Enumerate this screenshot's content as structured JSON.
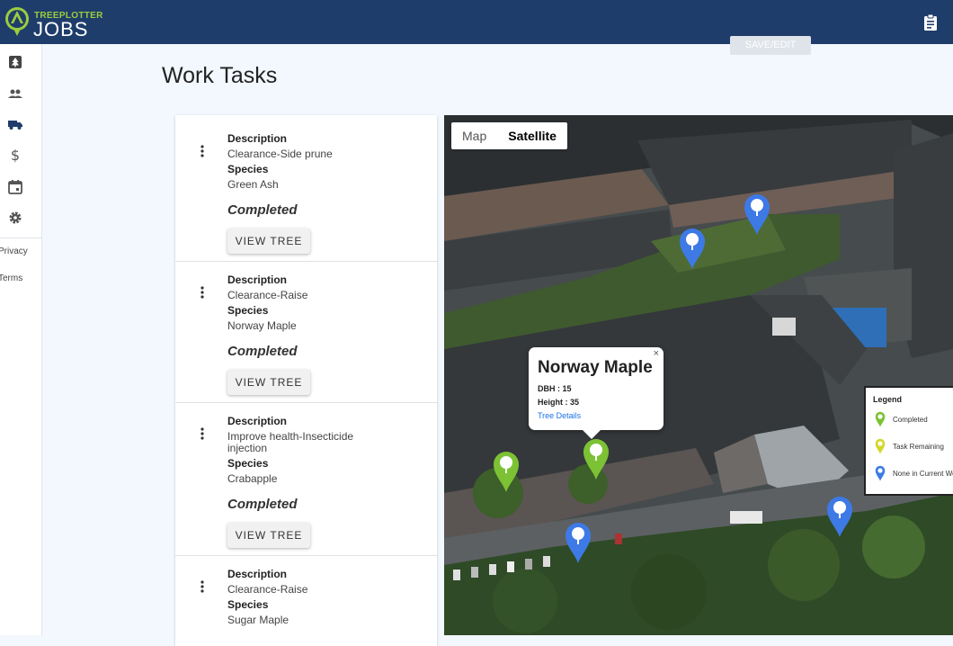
{
  "brand": {
    "top": "TREEPLOTTER",
    "bottom": "JOBS"
  },
  "header_action_label": "SAVE/EDIT",
  "page_title": "Work Tasks",
  "sidebar": {
    "links": [
      {
        "label": "Privacy"
      },
      {
        "label": "Terms"
      }
    ]
  },
  "tasks": [
    {
      "desc_label": "Description",
      "description": "Clearance-Side prune",
      "species_label": "Species",
      "species": "Green Ash",
      "status": "Completed",
      "button": "VIEW TREE"
    },
    {
      "desc_label": "Description",
      "description": "Clearance-Raise",
      "species_label": "Species",
      "species": "Norway Maple",
      "status": "Completed",
      "button": "VIEW TREE"
    },
    {
      "desc_label": "Description",
      "description": "Improve health-Insecticide injection",
      "species_label": "Species",
      "species": "Crabapple",
      "status": "Completed",
      "button": "VIEW TREE"
    },
    {
      "desc_label": "Description",
      "description": "Clearance-Raise",
      "species_label": "Species",
      "species": "Sugar Maple",
      "status": "",
      "button": ""
    }
  ],
  "map": {
    "toggle": {
      "map": "Map",
      "satellite": "Satellite"
    },
    "popup": {
      "title": "Norway Maple",
      "close": "×",
      "dbh": "DBH : 15",
      "height": "Height : 35",
      "link": "Tree Details"
    },
    "legend": {
      "title": "Legend",
      "items": [
        {
          "label": "Completed",
          "color": "#7cc234"
        },
        {
          "label": "Task Remaining",
          "color": "#d4d62a"
        },
        {
          "label": "None in Current Work",
          "color": "#3d7ae6"
        }
      ]
    },
    "pin_colors": {
      "completed": "#7cc234",
      "none": "#3d7ae6"
    }
  }
}
